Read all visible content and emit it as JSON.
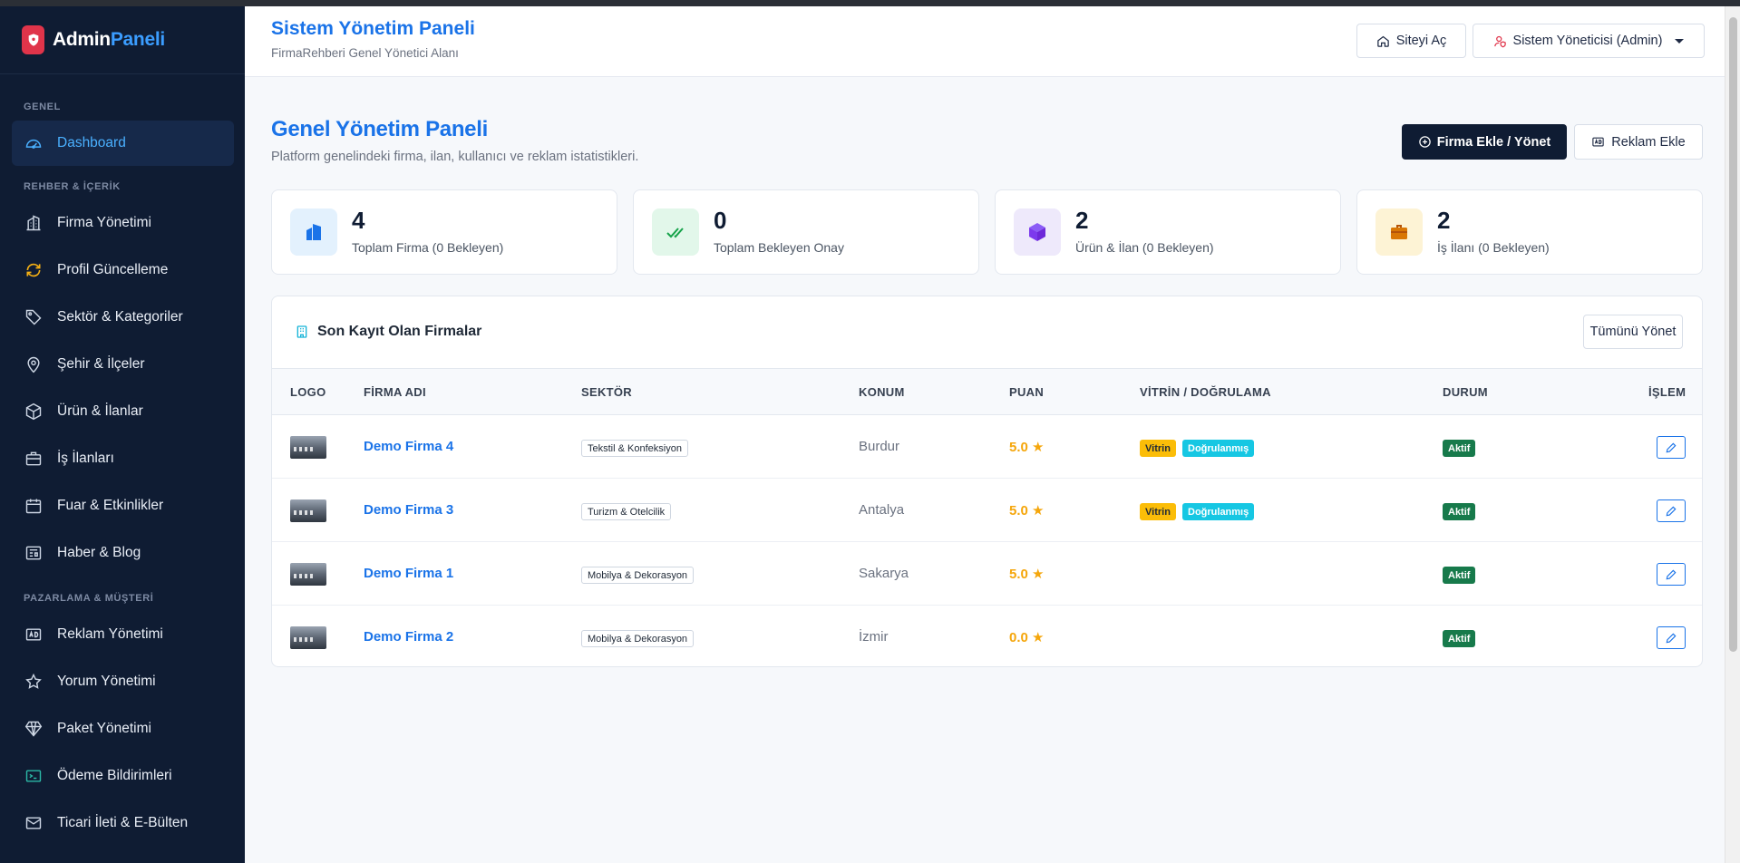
{
  "brand": {
    "part1": "Admin",
    "part2": "Paneli"
  },
  "sidebar": {
    "sections": [
      {
        "title": "GENEL"
      },
      {
        "title": "REHBER & İÇERİK"
      },
      {
        "title": "PAZARLAMA & MÜŞTERİ"
      }
    ],
    "items": [
      {
        "label": "Dashboard",
        "icon": "gauge-icon",
        "active": true
      },
      {
        "label": "Firma Yönetimi",
        "icon": "building-icon"
      },
      {
        "label": "Profil Güncelleme",
        "icon": "refresh-icon"
      },
      {
        "label": "Sektör & Kategoriler",
        "icon": "tags-icon"
      },
      {
        "label": "Şehir & İlçeler",
        "icon": "map-pin-icon"
      },
      {
        "label": "Ürün & İlanlar",
        "icon": "box-icon"
      },
      {
        "label": "İş İlanları",
        "icon": "briefcase-icon"
      },
      {
        "label": "Fuar & Etkinlikler",
        "icon": "calendar-icon"
      },
      {
        "label": "Haber & Blog",
        "icon": "newspaper-icon"
      },
      {
        "label": "Reklam Yönetimi",
        "icon": "ad-icon"
      },
      {
        "label": "Yorum Yönetimi",
        "icon": "star-icon"
      },
      {
        "label": "Paket Yönetimi",
        "icon": "gem-icon"
      },
      {
        "label": "Ödeme Bildirimleri",
        "icon": "terminal-icon"
      },
      {
        "label": "Ticari İleti & E-Bülten",
        "icon": "envelope-icon"
      }
    ]
  },
  "header": {
    "title": "Sistem Yönetim Paneli",
    "subtitle": "FirmaRehberi Genel Yönetici Alanı",
    "open_site_label": "Siteyi Aç",
    "user_label": "Sistem Yöneticisi (Admin)"
  },
  "page": {
    "title": "Genel Yönetim Paneli",
    "subtitle": "Platform genelindeki firma, ilan, kullanıcı ve reklam istatistikleri.",
    "add_firm_label": "Firma Ekle / Yönet",
    "add_ad_label": "Reklam Ekle"
  },
  "stats": [
    {
      "value": "4",
      "label": "Toplam Firma (0 Bekleyen)",
      "icon": "building-icon",
      "bg": "#e3f1fd",
      "color": "#1a73e8"
    },
    {
      "value": "0",
      "label": "Toplam Bekleyen Onay",
      "icon": "double-check-icon",
      "bg": "#e2f7ea",
      "color": "#16a34a"
    },
    {
      "value": "2",
      "label": "Ürün & İlan (0 Bekleyen)",
      "icon": "box-icon",
      "bg": "#eee9fb",
      "color": "#7c3aed"
    },
    {
      "value": "2",
      "label": "İş İlanı (0 Bekleyen)",
      "icon": "briefcase-icon",
      "bg": "#fdf3d5",
      "color": "#d97706"
    }
  ],
  "recent": {
    "title": "Son Kayıt Olan Firmalar",
    "manage_all_label": "Tümünü Yönet",
    "columns": [
      "LOGO",
      "FİRMA ADI",
      "SEKTÖR",
      "KONUM",
      "PUAN",
      "VİTRİN / DOĞRULAMA",
      "DURUM",
      "İŞLEM"
    ],
    "rows": [
      {
        "name": "Demo Firma 4",
        "sector": "Tekstil & Konfeksiyon",
        "location": "Burdur",
        "score": "5.0 ★",
        "vitrin": "Vitrin",
        "verified": "Doğrulanmış",
        "status": "Aktif"
      },
      {
        "name": "Demo Firma 3",
        "sector": "Turizm & Otelcilik",
        "location": "Antalya",
        "score": "5.0 ★",
        "vitrin": "Vitrin",
        "verified": "Doğrulanmış",
        "status": "Aktif"
      },
      {
        "name": "Demo Firma 1",
        "sector": "Mobilya & Dekorasyon",
        "location": "Sakarya",
        "score": "5.0 ★",
        "vitrin": "",
        "verified": "",
        "status": "Aktif"
      },
      {
        "name": "Demo Firma 2",
        "sector": "Mobilya & Dekorasyon",
        "location": "İzmir",
        "score": "0.0 ★",
        "vitrin": "",
        "verified": "",
        "status": "Aktif"
      }
    ]
  }
}
